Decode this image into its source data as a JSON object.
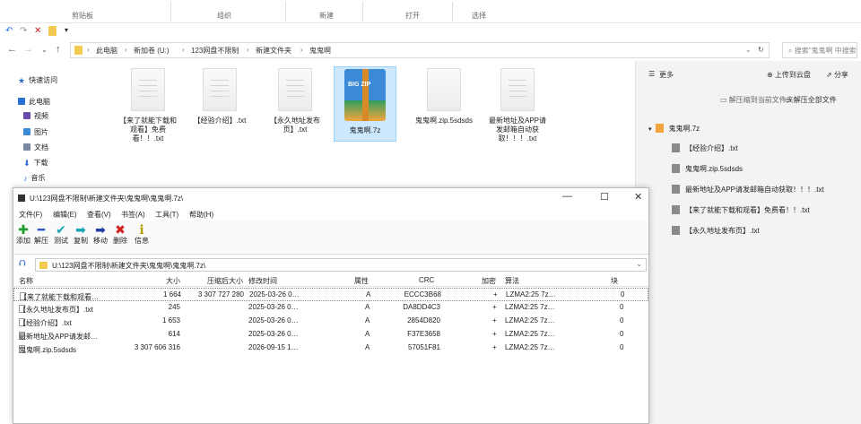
{
  "ribbon": {
    "groups": [
      "剪贴板",
      "组织",
      "新建",
      "打开",
      "选择"
    ]
  },
  "explorer": {
    "breadcrumb": [
      "此电脑",
      "新加卷 (U:)",
      "123网盘不限制",
      "新建文件夹",
      "鬼鬼啊"
    ],
    "search_placeholder": "搜索\"鬼鬼啊 中搜索",
    "nav": [
      "快速访问",
      "此电脑",
      "视频",
      "图片",
      "文档",
      "下载",
      "音乐"
    ],
    "files": [
      {
        "label": "【来了就能下载和观看】免费看！！.txt"
      },
      {
        "label": "【经验介绍】.txt"
      },
      {
        "label": "【永久地址发布页】.txt"
      },
      {
        "label": "鬼鬼啊.7z",
        "zip_text": "BIG ZIP"
      },
      {
        "label": "鬼鬼啊.zip.5sdsds"
      },
      {
        "label": "最新地址及APP请发邮箱自动获取！！！.txt"
      }
    ]
  },
  "right_panel": {
    "more": "更多",
    "upload": "上传到云盘",
    "share": "分享",
    "extract_here": "解压缩到当前文件夹",
    "extract_all": "解压全部文件",
    "archive": "鬼鬼啊.7z",
    "items": [
      "【经验介绍】.txt",
      "鬼鬼啊.zip.5sdsds",
      "最新地址及APP请发邮箱自动获取！！！.txt",
      "【来了就能下载和观看】免费看！！.txt",
      "【永久地址发布页】.txt"
    ]
  },
  "archiver": {
    "title": "U:\\123网盘不限制\\新建文件夹\\鬼鬼啊\\鬼鬼啊.7z\\",
    "menu": [
      "文件(F)",
      "编辑(E)",
      "查看(V)",
      "书签(A)",
      "工具(T)",
      "帮助(H)"
    ],
    "tools": [
      {
        "label": "添加",
        "glyph": "✚",
        "color": "#1e9e2e"
      },
      {
        "label": "解压",
        "glyph": "━",
        "color": "#2f57c9"
      },
      {
        "label": "测试",
        "glyph": "✔",
        "color": "#1aa5b5"
      },
      {
        "label": "复制",
        "glyph": "➡",
        "color": "#1aa5b5"
      },
      {
        "label": "移动",
        "glyph": "➡",
        "color": "#1f3fa5"
      },
      {
        "label": "删除",
        "glyph": "✖",
        "color": "#d02020"
      },
      {
        "label": "信息",
        "glyph": "ℹ",
        "color": "#b59a00"
      }
    ],
    "path": "U:\\123网盘不限制\\新建文件夹\\鬼鬼啊\\鬼鬼啊.7z\\",
    "columns": [
      "名称",
      "大小",
      "压缩后大小",
      "修改时间",
      "属性",
      "CRC",
      "加密",
      "算法",
      "块"
    ],
    "rows": [
      {
        "name": "【来了就能下载和观看…",
        "size": "1 664",
        "packed": "3 307 727 280",
        "modified": "2025-03-26 0…",
        "attr": "A",
        "crc": "ECCC3B68",
        "enc": "+",
        "method": "LZMA2:25 7z…",
        "block": "0"
      },
      {
        "name": "【永久地址发布页】.txt",
        "size": "245",
        "packed": "",
        "modified": "2025-03-26 0…",
        "attr": "A",
        "crc": "DA8DD4C3",
        "enc": "+",
        "method": "LZMA2:25 7z…",
        "block": "0"
      },
      {
        "name": "【经验介绍】.txt",
        "size": "1 653",
        "packed": "",
        "modified": "2025-03-26 0…",
        "attr": "A",
        "crc": "2854D820",
        "enc": "+",
        "method": "LZMA2:25 7z…",
        "block": "0"
      },
      {
        "name": "最新地址及APP请发邮…",
        "size": "614",
        "packed": "",
        "modified": "2025-03-26 0…",
        "attr": "A",
        "crc": "F37E3658",
        "enc": "+",
        "method": "LZMA2:25 7z…",
        "block": "0"
      },
      {
        "name": "鬼鬼啊.zip.5sdsds",
        "size": "3 307 606 316",
        "packed": "",
        "modified": "2026-09-15 1…",
        "attr": "A",
        "crc": "57051F81",
        "enc": "+",
        "method": "LZMA2:25 7z…",
        "block": "0"
      }
    ]
  }
}
